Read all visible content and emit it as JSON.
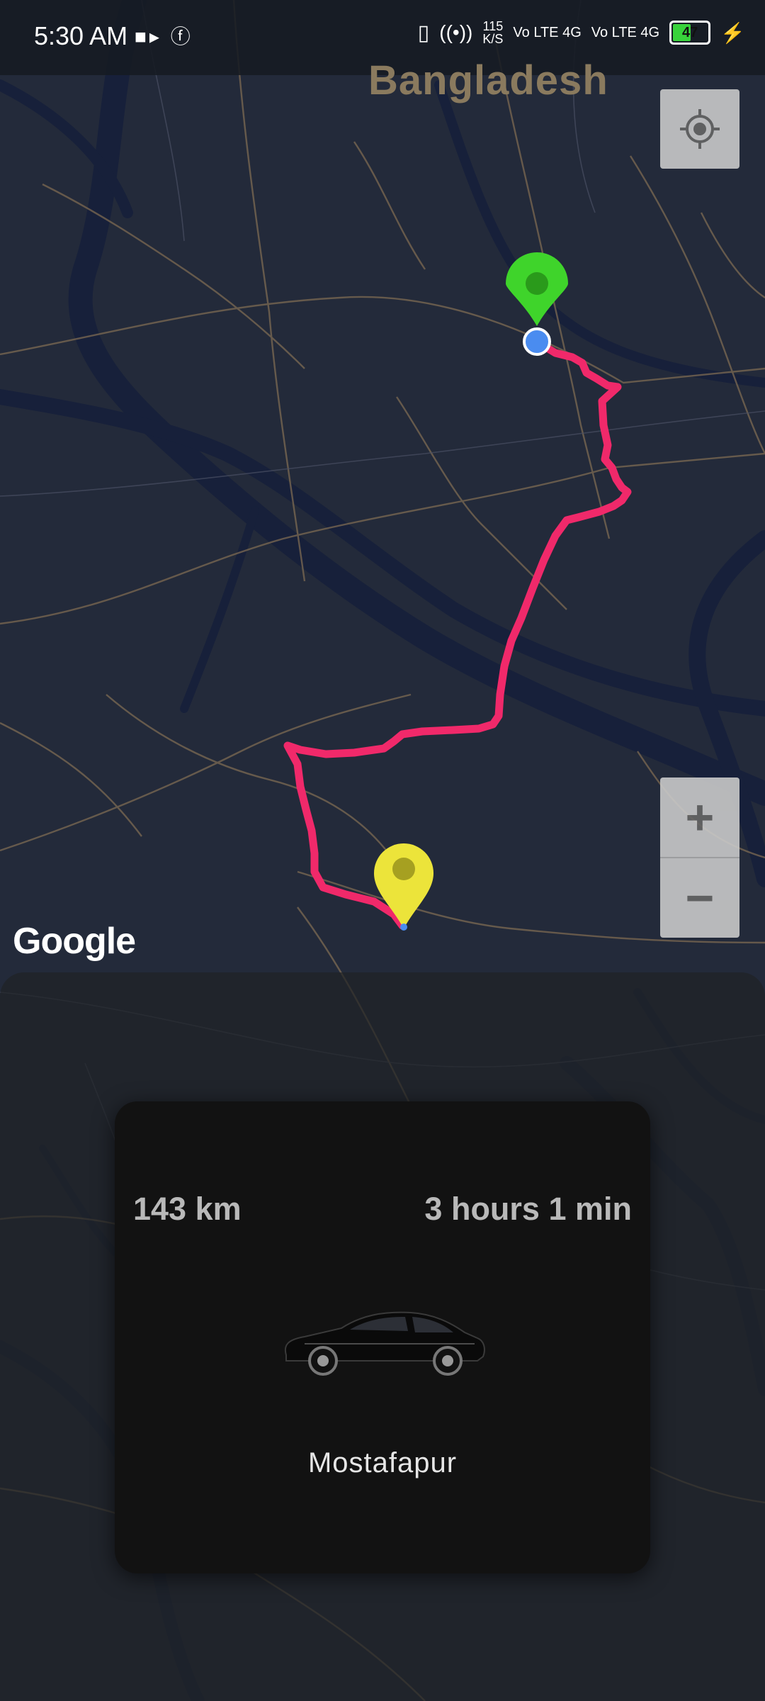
{
  "status_bar": {
    "time": "5:30 AM",
    "left_icons": [
      "video-icon",
      "facebook-icon"
    ],
    "net_speed": "115",
    "net_unit": "K/S",
    "sim1": "Vo LTE 4G",
    "sim2": "Vo LTE 4G",
    "battery": "47",
    "battery_level": 0.47,
    "battery_color": "#38d23b"
  },
  "map": {
    "country_label": "Bangladesh",
    "provider_logo": "Google",
    "route_color": "#f0296a",
    "origin_marker_color": "#3fd42b",
    "destination_marker_color": "#ece43a",
    "controls": {
      "locate_icon": "my-location-icon",
      "zoom_in": "+",
      "zoom_out": "−"
    }
  },
  "trip": {
    "distance": "143 km",
    "duration": "3 hours 1 min",
    "vehicle_icon": "car-icon",
    "destination": "Mostafapur"
  }
}
